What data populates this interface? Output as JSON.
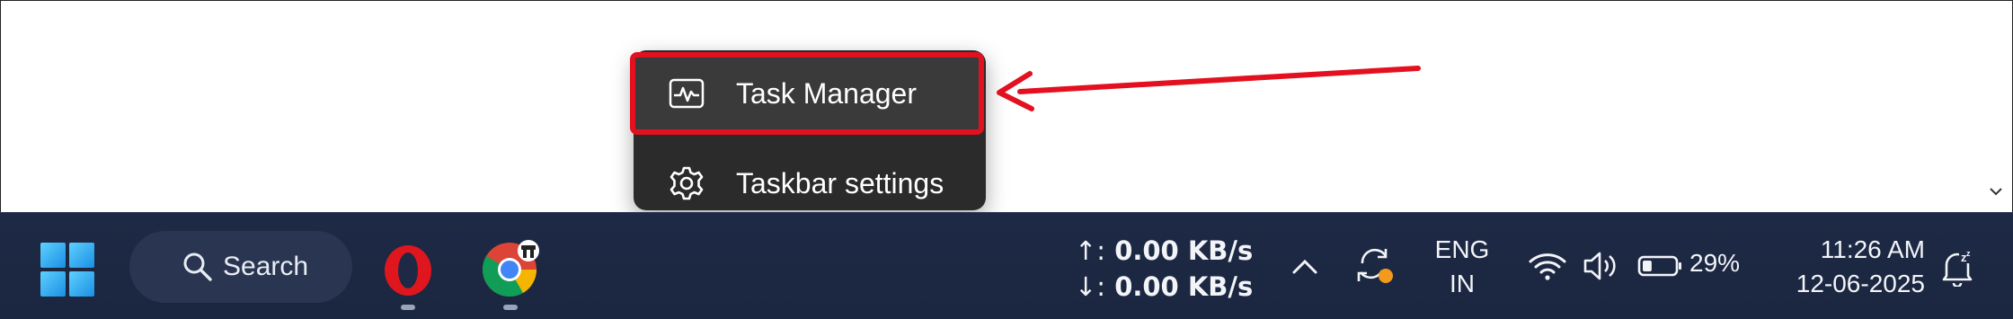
{
  "context_menu": {
    "items": [
      {
        "label": "Task Manager",
        "icon": "task-manager-icon",
        "highlighted": true
      },
      {
        "label": "Taskbar settings",
        "icon": "gear-icon",
        "highlighted": false
      }
    ]
  },
  "taskbar": {
    "start_icon": "windows-logo-icon",
    "search": {
      "label": "Search",
      "icon": "search-icon"
    },
    "apps": [
      {
        "name": "Opera",
        "icon": "opera-icon"
      },
      {
        "name": "Chrome",
        "icon": "chrome-icon"
      }
    ],
    "network_speed": {
      "up_arrow": "↑:",
      "up_value": "0.00 KB/s",
      "down_arrow": "↓:",
      "down_value": "0.00 KB/s"
    },
    "tray": {
      "language_line1": "ENG",
      "language_line2": "IN",
      "battery_percent": "29%",
      "battery_level": 0.29
    },
    "clock": {
      "time": "11:26 AM",
      "date": "12-06-2025"
    }
  },
  "colors": {
    "highlight_border": "#e3101f",
    "taskbar_bg": "#1e2a45",
    "menu_bg": "#2b2b2b",
    "opera_red": "#e0161f"
  }
}
